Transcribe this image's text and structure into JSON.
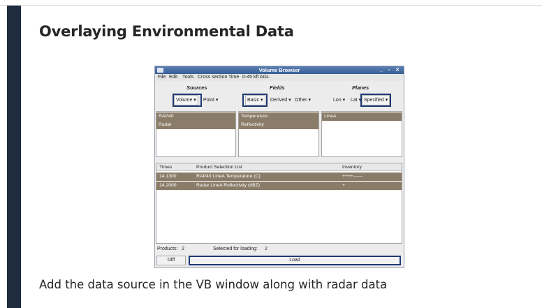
{
  "slide": {
    "title": "Overlaying Environmental Data",
    "caption": "Add the data source in the VB window along with radar data"
  },
  "window": {
    "title": "Volume Browser",
    "controls": "_ ▫ ✕",
    "menu": [
      "File",
      "Edit",
      "Tools",
      "Cross section",
      "Time",
      "0-45 kft AGL"
    ],
    "sections": {
      "sources": "Sources",
      "fields": "Fields",
      "planes": "Planes"
    },
    "dropdowns": {
      "volume": "Volume ▾",
      "point": "Point ▾",
      "basic": "Basic ▾",
      "derived": "Derived ▾",
      "other": "Other ▾",
      "lon": "Lon ▾",
      "lat": "Lat ▾",
      "specified": "Specified ▾"
    },
    "sources_list": [
      "RAP40",
      "Radar"
    ],
    "fields_list": [
      "Temperature",
      "Reflectivity"
    ],
    "planes_list": [
      "LineA"
    ],
    "product_list": {
      "headers": {
        "times": "Times",
        "product": "Product Selection List",
        "inventory": "Inventory"
      },
      "rows": [
        {
          "time": "14.1300",
          "product": "RAP40 LineA Temperature (C)",
          "inventory": "++++------"
        },
        {
          "time": "14.2000",
          "product": "Radar LineA Reflectivity (dBZ)",
          "inventory": "+"
        }
      ]
    },
    "status": {
      "products_label": "Products:",
      "products_count": "2",
      "selected_label": "Selected for loading:",
      "selected_count": "2"
    },
    "buttons": {
      "diff": "Diff",
      "load": "Load"
    }
  }
}
